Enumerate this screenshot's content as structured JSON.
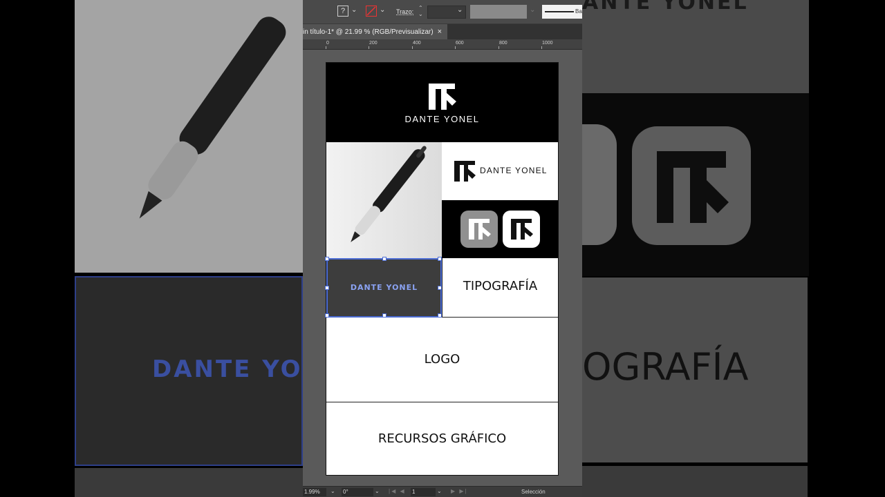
{
  "toolbar": {
    "fill_icon": "?",
    "stroke_label": "Trazo:",
    "stroke_weight_value": "",
    "line_style_label": "Ba"
  },
  "document_tab": {
    "title": "in título-1* @ 21.99 % (RGB/Previsualizar)",
    "close": "×"
  },
  "ruler": {
    "ticks": [
      "0",
      "200",
      "400",
      "600",
      "800",
      "1000"
    ]
  },
  "artboard": {
    "hero_brand": "DANTE YONEL",
    "horizontal_logo_brand": "DANTE YONEL",
    "selected_text": "DANTE YONEL",
    "tipografia_label": "TIPOGRAFÍA",
    "logo_label": "LOGO",
    "recursos_label": "RECURSOS GRÁFICO"
  },
  "background": {
    "left_ghost_text": "DANTE YO",
    "right_ghost_title": "ANTE YONEL",
    "right_ghost_tipo": "OGRAFÍA"
  },
  "statusbar": {
    "zoom": "1.99%",
    "rotation": "0°",
    "artboard_number": "1",
    "tool": "Selección"
  },
  "colors": {
    "selection": "#4a6bd4",
    "selected_text": "#8aa2f2",
    "panel_bg": "#535353"
  }
}
